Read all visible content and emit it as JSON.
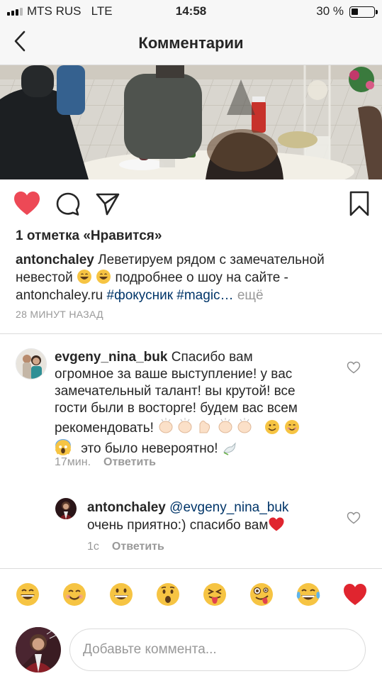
{
  "status_bar": {
    "carrier": "MTS RUS",
    "network": "LTE",
    "time": "14:58",
    "battery": "30 %",
    "battery_level": 0.3
  },
  "header": {
    "title": "Комментарии"
  },
  "post": {
    "likes": "1 отметка «Нравится»",
    "author": "antonchaley",
    "caption_line1": "Леветируем рядом с замечательной",
    "caption_line2_text": "невестой",
    "caption_line2_rest": "подробнее о шоу на сайте -",
    "caption_site": "antonchaley.ru",
    "caption_tags": "#фокусник #magic…",
    "more": "ещё",
    "time_ago": "28 МИНУТ НАЗАД"
  },
  "comments": [
    {
      "user": "evgeny_nina_buk",
      "line1": "Спасибо вам",
      "line2": "огромное за ваше выступление! у вас",
      "line3": "замечательный талант! вы крутой! все",
      "line4": "гости были в восторге! будем вас всем",
      "line5": "рекомендовать!",
      "line6": "это было невероятно!",
      "time": "17мин.",
      "reply": "Ответить"
    },
    {
      "user": "antonchaley",
      "mention": "@evgeny_nina_buk",
      "text": "очень приятно:) спасибо вам",
      "time": "1с",
      "reply": "Ответить"
    }
  ],
  "emoji_bar": [
    "grinning-face",
    "smiling-face",
    "big-grin-face",
    "surprised-face",
    "squinting-tongue-face",
    "zany-face",
    "tears-of-joy-face",
    "red-heart"
  ],
  "composer": {
    "placeholder": "Добавьте коммента..."
  },
  "colors": {
    "like_red": "#ed4956",
    "tag_blue": "#003569",
    "muted": "#999999"
  }
}
